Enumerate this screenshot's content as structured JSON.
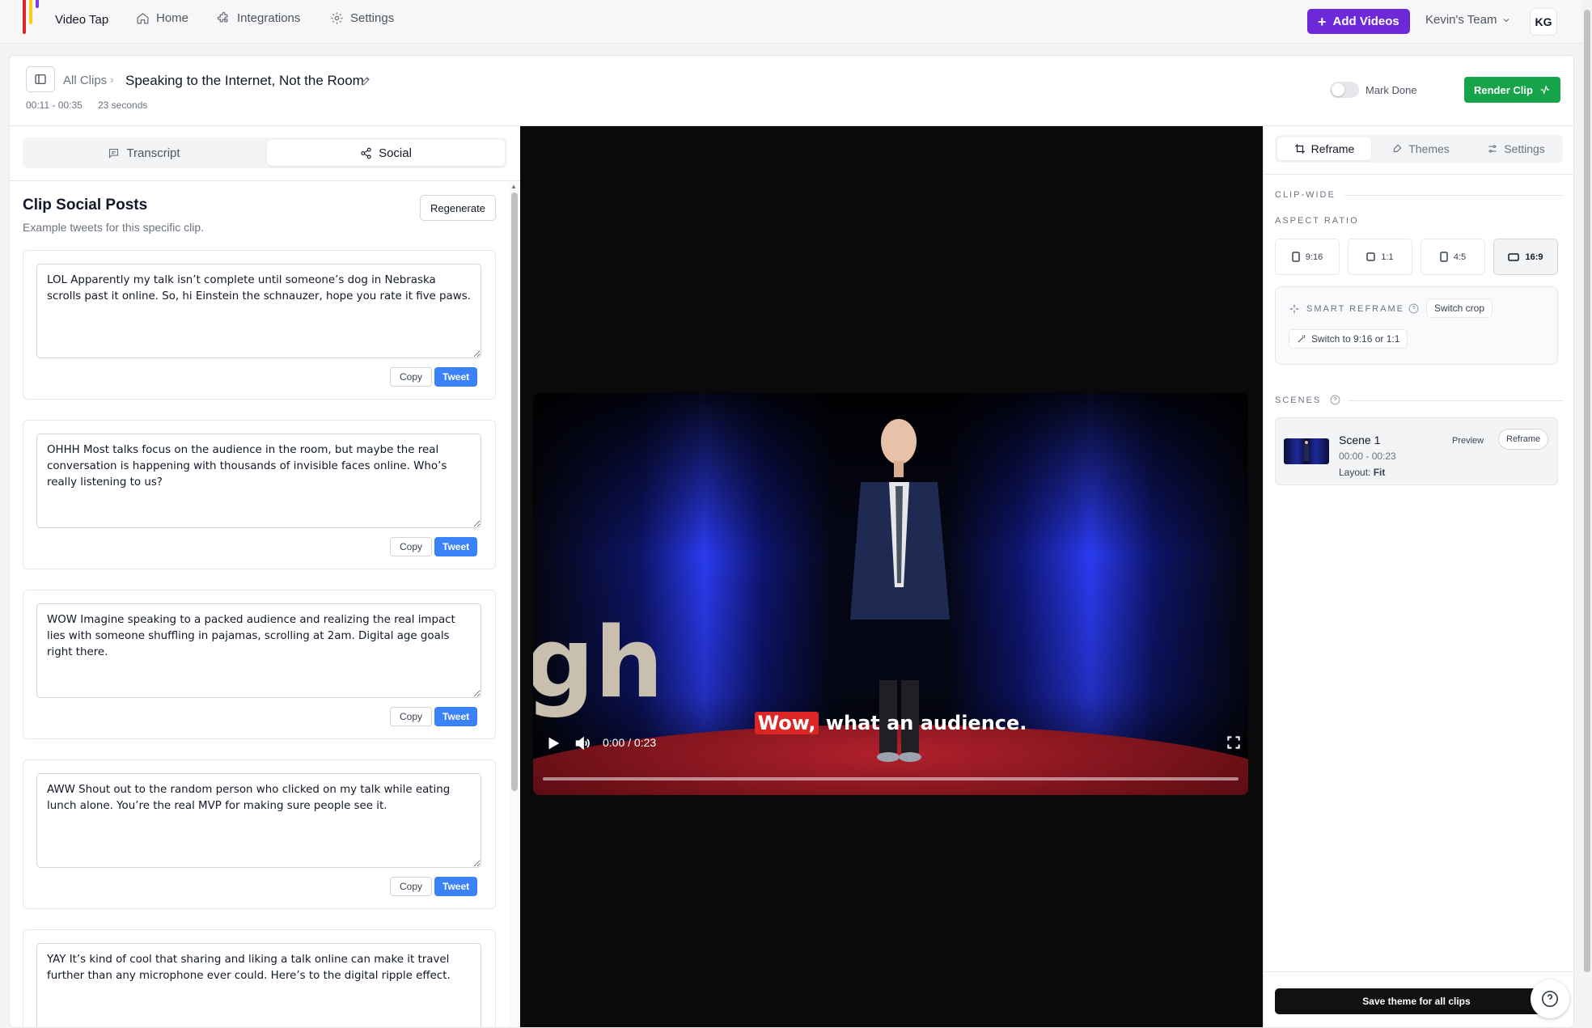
{
  "app": {
    "brand": "Video Tap",
    "logo_colors": [
      "#dc2626",
      "#facc15",
      "#7c3aed"
    ]
  },
  "nav": {
    "home": "Home",
    "integrations": "Integrations",
    "settings": "Settings",
    "add_videos": "Add Videos",
    "team": "Kevin's Team",
    "avatar_initials": "KG"
  },
  "header": {
    "breadcrumb_all": "All Clips",
    "breadcrumb_sep": "›",
    "clip_title": "Speaking to the Internet, Not the Room",
    "time_range": "00:11 - 00:35",
    "duration": "23 seconds",
    "mark_done_label": "Mark Done",
    "mark_done_on": false,
    "render_label": "Render Clip"
  },
  "left_panel": {
    "tabs": [
      {
        "label": "Transcript",
        "active": false
      },
      {
        "label": "Social",
        "active": true
      }
    ],
    "title": "Clip Social Posts",
    "subtitle": "Example tweets for this specific clip.",
    "regenerate_label": "Regenerate",
    "copy_label": "Copy",
    "tweet_label": "Tweet",
    "posts": [
      {
        "text": "LOL Apparently my talk isn’t complete until someone’s dog in Nebraska scrolls past it online. So, hi Einstein the schnauzer, hope you rate it five paws."
      },
      {
        "text": "OHHH Most talks focus on the audience in the room, but maybe the real conversation is happening with thousands of invisible faces online. Who’s really listening to us?"
      },
      {
        "text": "WOW Imagine speaking to a packed audience and realizing the real impact lies with someone shuffling in pajamas, scrolling at 2am. Digital age goals right there."
      },
      {
        "text": "AWW Shout out to the random person who clicked on my talk while eating lunch alone. You’re the real MVP for making sure people see it."
      },
      {
        "text": "YAY It’s kind of cool that sharing and liking a talk online can make it travel further than any microphone ever could. Here’s to the digital ripple effect."
      }
    ]
  },
  "video": {
    "subtitle_highlight": "Wow,",
    "subtitle_rest": " what an audience.",
    "time": "0:00 / 0:23",
    "progress": 0,
    "stage_letters": "gh",
    "highlight_color": "#dc2626"
  },
  "right_panel": {
    "tabs": [
      {
        "label": "Reframe",
        "active": true
      },
      {
        "label": "Themes",
        "active": false
      },
      {
        "label": "Settings",
        "active": false
      }
    ],
    "clip_wide_label": "CLIP-WIDE",
    "aspect_ratio_label": "ASPECT RATIO",
    "aspect_ratios": [
      {
        "label": "9:16",
        "active": false
      },
      {
        "label": "1:1",
        "active": false
      },
      {
        "label": "4:5",
        "active": false
      },
      {
        "label": "16:9",
        "active": true
      }
    ],
    "smart_reframe_label": "SMART REFRAME",
    "switch_crop_label": "Switch crop",
    "switch_to_label": "Switch to 9:16 or 1:1",
    "scenes_label": "SCENES",
    "scenes": [
      {
        "name": "Scene 1",
        "time": "00:00 - 00:23",
        "layout_label": "Layout:",
        "layout_value": "Fit",
        "preview_label": "Preview",
        "reframe_label": "Reframe"
      }
    ],
    "save_theme_label": "Save theme for all clips"
  },
  "colors": {
    "accent": "#6d28d9",
    "render": "#16a34a",
    "tweet": "#3b82f6"
  }
}
